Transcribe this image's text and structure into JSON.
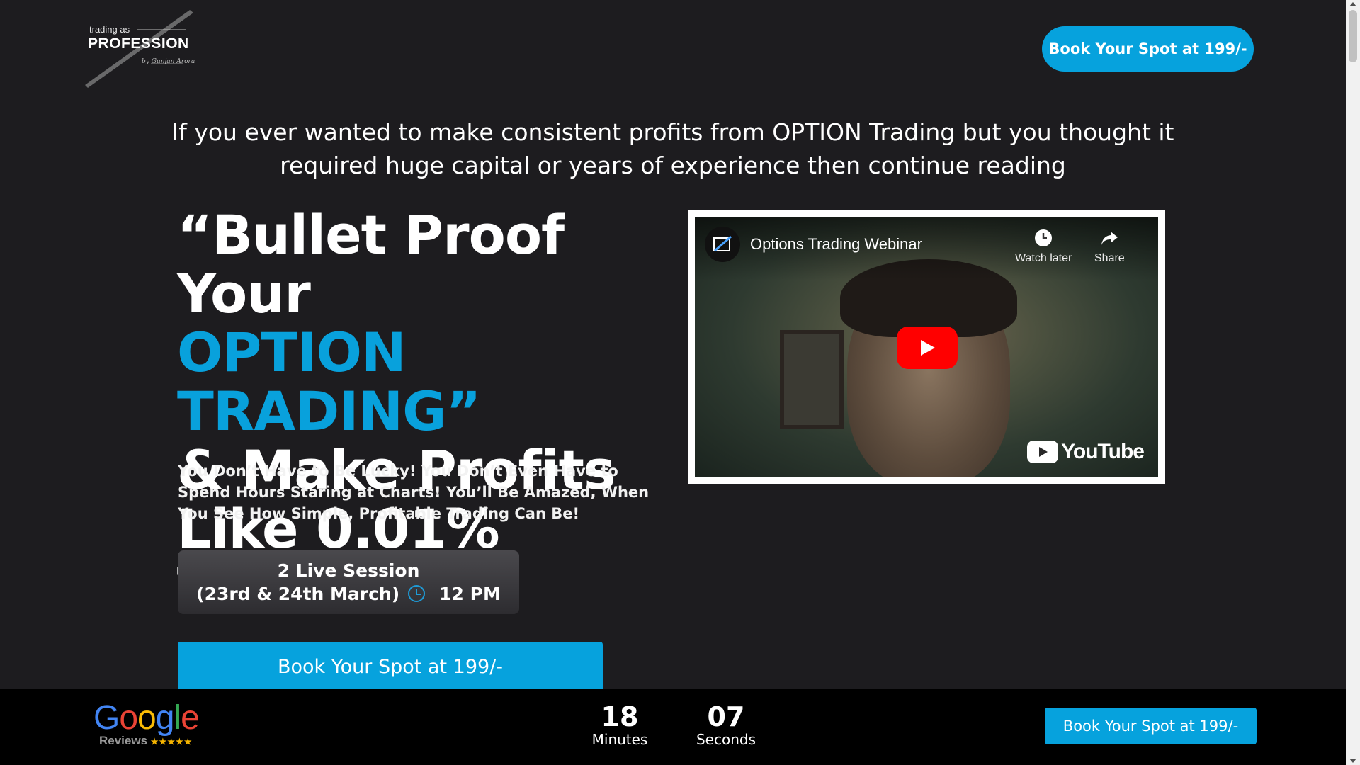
{
  "logo": {
    "line1": "trading as",
    "line2": "PROFESSION",
    "signature": "by Gunjan Arora"
  },
  "header": {
    "cta_label": "Book Your Spot at 199/-"
  },
  "intro": {
    "text": "If you ever wanted to make consistent profits from OPTION Trading but you thought it required huge capital or years of experience then continue reading"
  },
  "headline": {
    "line1": "“Bullet Proof Your",
    "line2": "OPTION TRADING”",
    "line3": "& Make Profits",
    "line4": "Like 0.01% Trader"
  },
  "subtext": "You Don’t Have to Be Lucky! You Don’t Even Have to Spend Hours Staring at Charts! You’ll Be Amazed, When You See How Simple, Profitable Trading Can Be!",
  "session": {
    "line1": "2 Live Session",
    "dates": "(23rd & 24th March)",
    "time": "12 PM"
  },
  "main_cta": {
    "label": "Book Your Spot at 199/-"
  },
  "video": {
    "title": "Options Trading Webinar",
    "watch_later": "Watch later",
    "share": "Share",
    "brand": "YouTube"
  },
  "footer": {
    "google": {
      "g1": "G",
      "o1": "o",
      "o2": "o",
      "g2": "g",
      "l": "l",
      "e": "e",
      "reviews_label": "Reviews",
      "stars": "★★★★★"
    },
    "countdown": {
      "minutes_value": "18",
      "minutes_label": "Minutes",
      "seconds_value": "07",
      "seconds_label": "Seconds"
    },
    "cta_label": "Book Your Spot at 199/-"
  },
  "colors": {
    "background": "#1d1c1f",
    "accent_blue": "#06a2dd",
    "footer_bg": "#000000",
    "youtube_red": "#ff0000"
  }
}
